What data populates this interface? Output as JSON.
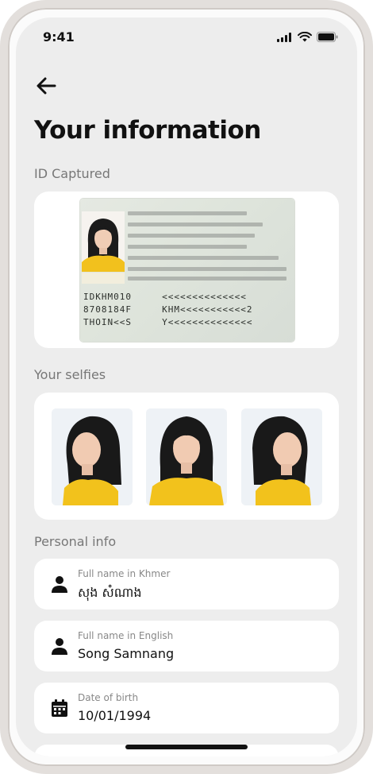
{
  "status": {
    "time": "9:41"
  },
  "header": {
    "title": "Your information"
  },
  "id_section": {
    "label": "ID Captured",
    "mrz": [
      "IDKHM010",
      "8708184F",
      "THOIN<<S"
    ],
    "mrz_right": [
      "<<<<<<<<<<<<<<",
      "KHM<<<<<<<<<<<2",
      "Y<<<<<<<<<<<<<<"
    ]
  },
  "selfie_section": {
    "label": "Your selfies"
  },
  "personal": {
    "label": "Personal info",
    "fields": [
      {
        "label": "Full name in Khmer",
        "value": "សុង សំណាង",
        "icon": "person-icon"
      },
      {
        "label": "Full name in English",
        "value": "Song Samnang",
        "icon": "person-icon"
      },
      {
        "label": "Date of birth",
        "value": "10/01/1994",
        "icon": "calendar-icon"
      }
    ]
  },
  "colors": {
    "background": "#ededed",
    "card": "#ffffff",
    "label": "#777777",
    "text": "#111111"
  }
}
